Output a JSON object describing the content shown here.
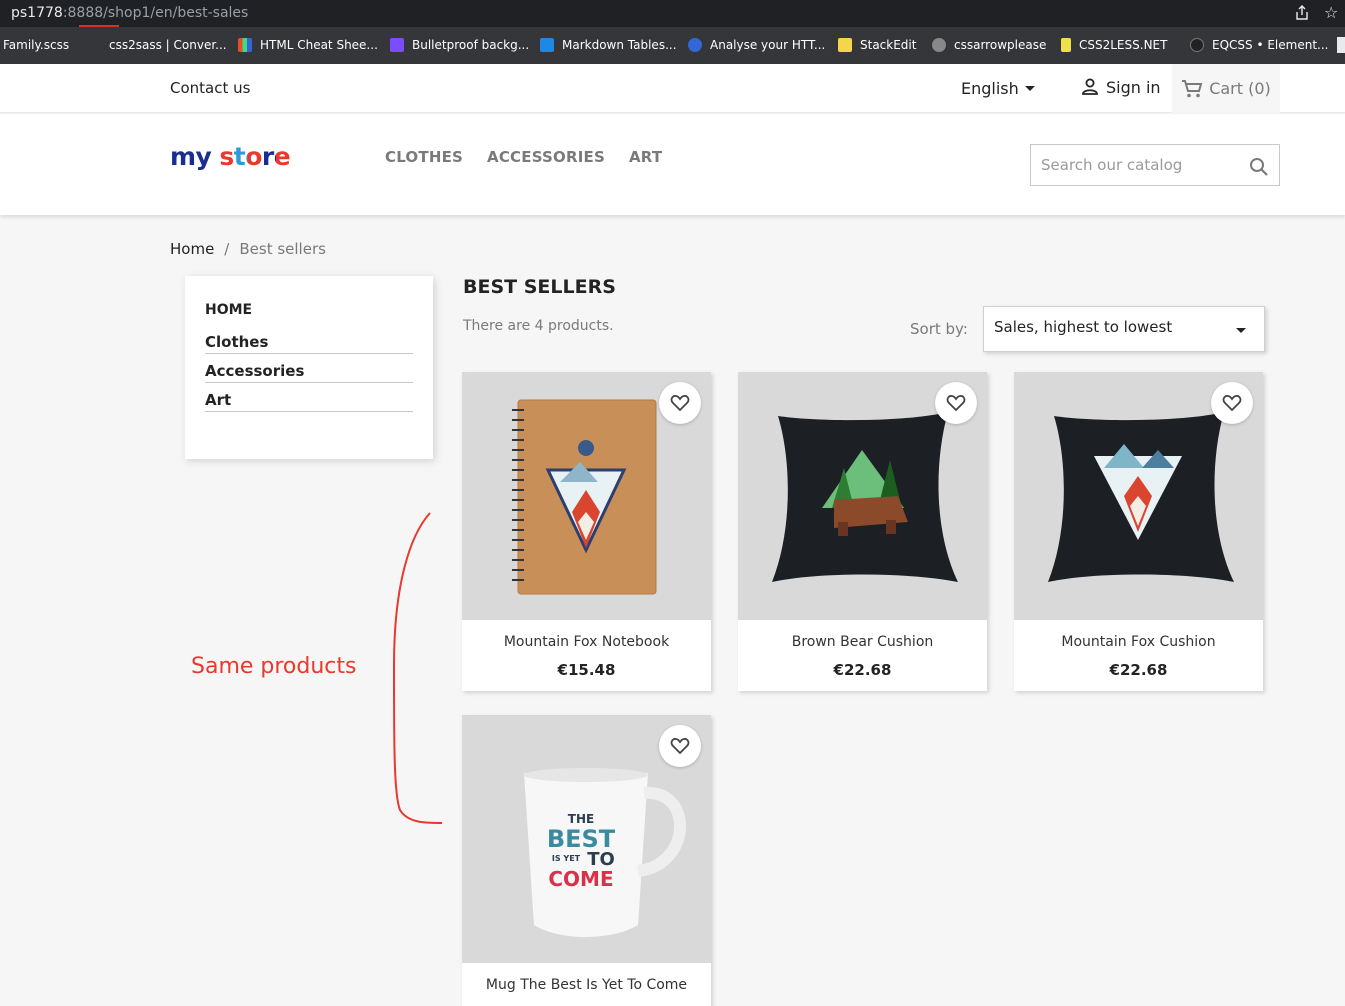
{
  "browser": {
    "url_host": "ps1778",
    "url_rest": ":8888/shop1/en/best-sales",
    "bookmarks": [
      {
        "label": "Family.scss",
        "color": "#35363a"
      },
      {
        "label": "css2sass | Conver...",
        "color": "#35363a"
      },
      {
        "label": "HTML Cheat Shee...",
        "color": "#e34f26"
      },
      {
        "label": "Bulletproof backg...",
        "color": "#7b4dff"
      },
      {
        "label": "Markdown Tables...",
        "color": "#1e88e5"
      },
      {
        "label": "Analyse your HTT...",
        "color": "#3367d6"
      },
      {
        "label": "StackEdit",
        "color": "#f6d54b"
      },
      {
        "label": "cssarrowplease",
        "color": "#888888"
      },
      {
        "label": "CSS2LESS.NET",
        "color": "#f0e14a"
      },
      {
        "label": "EQCSS • Element...",
        "color": "#222222"
      }
    ]
  },
  "topnav": {
    "contact": "Contact us",
    "language": "English",
    "signin": "Sign in",
    "cart": "Cart (0)"
  },
  "header": {
    "logo_my": "my",
    "logo_store": "store",
    "nav": [
      "CLOTHES",
      "ACCESSORIES",
      "ART"
    ],
    "search_placeholder": "Search our catalog"
  },
  "breadcrumb": {
    "home": "Home",
    "separator": "/",
    "current": "Best sellers"
  },
  "sidebar": {
    "home": "HOME",
    "categories": [
      "Clothes",
      "Accessories",
      "Art"
    ]
  },
  "annotation": {
    "text": "Same products",
    "color": "#e8392c"
  },
  "listing": {
    "title": "BEST SELLERS",
    "count_text": "There are 4 products.",
    "sort_label": "Sort by:",
    "sort_value": "Sales, highest to lowest"
  },
  "products": [
    {
      "name": "Mountain Fox Notebook",
      "price": "€15.48",
      "image": "notebook"
    },
    {
      "name": "Brown Bear Cushion",
      "price": "€22.68",
      "image": "cushion-bear"
    },
    {
      "name": "Mountain Fox Cushion",
      "price": "€22.68",
      "image": "cushion-fox"
    },
    {
      "name": "Mug The Best Is Yet To Come",
      "price": "",
      "image": "mug",
      "mug_text": [
        "THE",
        "BEST",
        "IS YET",
        "TO",
        "COME"
      ]
    }
  ]
}
